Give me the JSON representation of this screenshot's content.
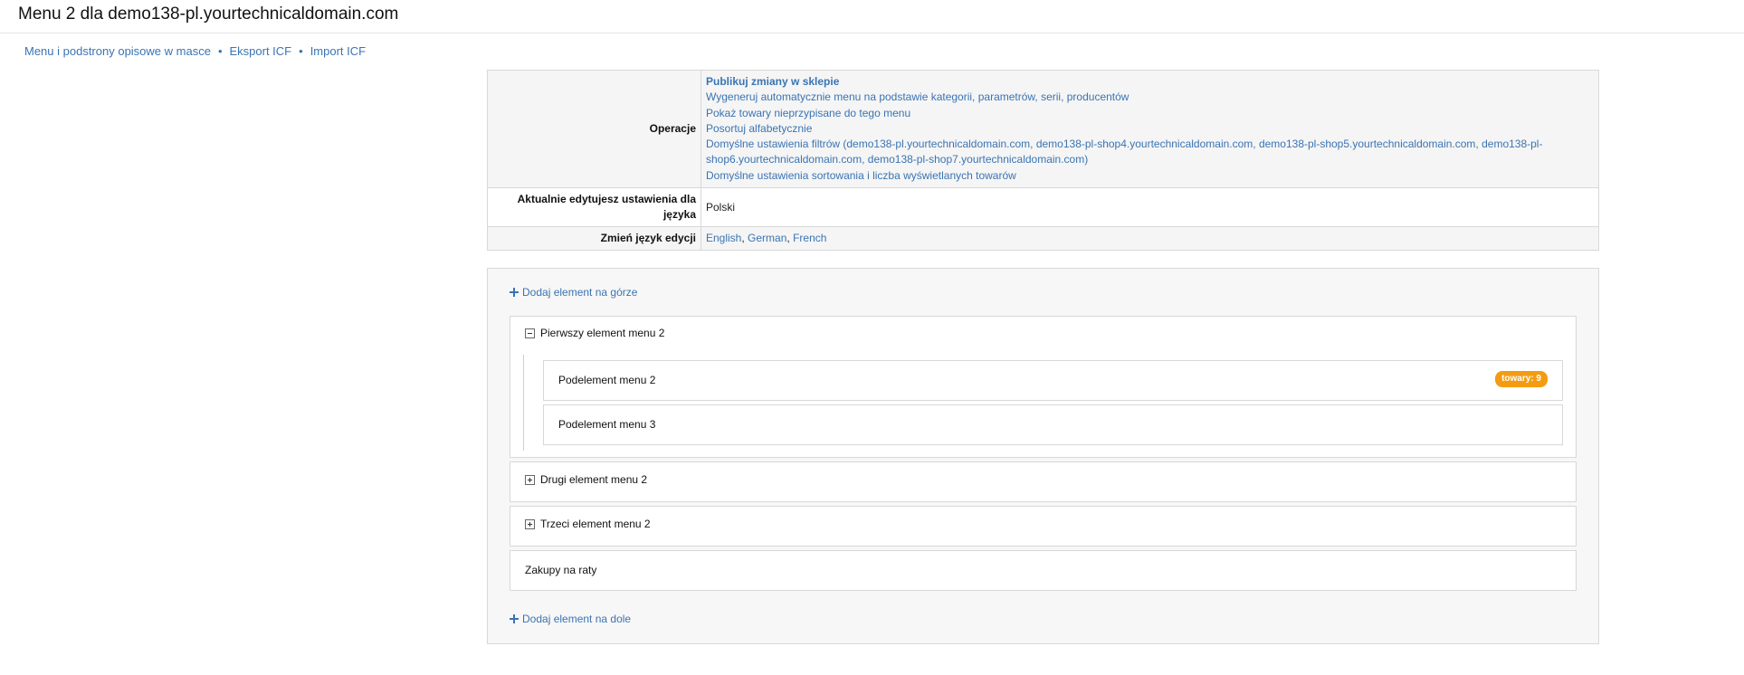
{
  "page": {
    "title": "Menu 2 dla demo138-pl.yourtechnicaldomain.com"
  },
  "subnav": {
    "items": [
      "Menu i podstrony opisowe w masce",
      "Eksport ICF",
      "Import ICF"
    ],
    "separator": "•"
  },
  "settings": {
    "operations_label": "Operacje",
    "operations": [
      "Publikuj zmiany w sklepie",
      "Wygeneruj automatycznie menu na podstawie kategorii, parametrów, serii, producentów",
      "Pokaż towary nieprzypisane do tego menu",
      "Posortuj alfabetycznie",
      "Domyślne ustawienia filtrów (demo138-pl.yourtechnicaldomain.com, demo138-pl-shop4.yourtechnicaldomain.com, demo138-pl-shop5.yourtechnicaldomain.com, demo138-pl-shop6.yourtechnicaldomain.com, demo138-pl-shop7.yourtechnicaldomain.com)",
      "Domyślne ustawienia sortowania i liczba wyświetlanych towarów"
    ],
    "current_lang_label": "Aktualnie edytujesz ustawienia dla języka",
    "current_lang_value": "Polski",
    "change_lang_label": "Zmień język edycji",
    "languages": [
      "English",
      "German",
      "French"
    ],
    "lang_separator": ", "
  },
  "editor": {
    "add_top": "Dodaj element na górze",
    "add_bottom": "Dodaj element na dole",
    "items": [
      {
        "label": "Pierwszy element menu 2",
        "expanded": true,
        "children": [
          {
            "label": "Podelement menu 2",
            "badge": "towary: 9"
          },
          {
            "label": "Podelement menu 3"
          }
        ]
      },
      {
        "label": "Drugi element menu 2",
        "expanded": false
      },
      {
        "label": "Trzeci element menu 2",
        "expanded": false
      },
      {
        "label": "Zakupy na raty"
      }
    ]
  },
  "colors": {
    "link": "#3a74b3",
    "badge": "#f39c12"
  }
}
